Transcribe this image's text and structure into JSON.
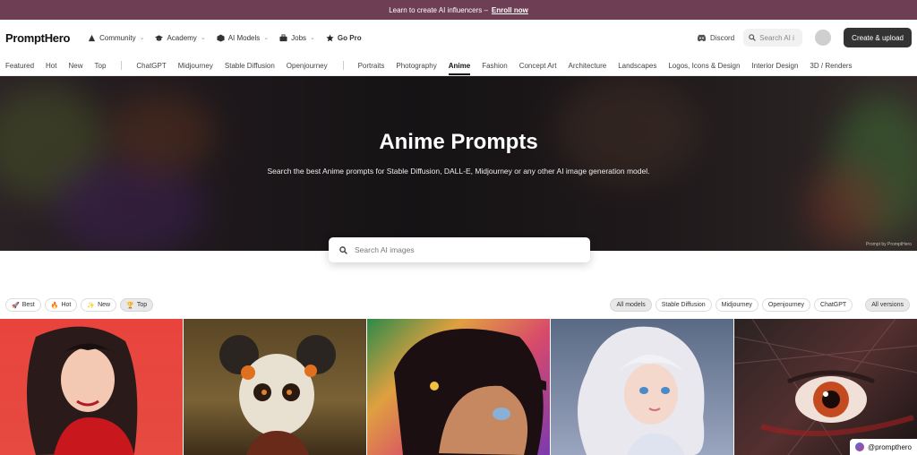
{
  "banner": {
    "text": "Learn to create AI influencers –",
    "link": "Enroll now"
  },
  "header": {
    "logo": "PromptHero",
    "nav": [
      {
        "label": "Community",
        "icon": "community-icon"
      },
      {
        "label": "Academy",
        "icon": "graduation-cap-icon"
      },
      {
        "label": "AI Models",
        "icon": "cube-icon"
      },
      {
        "label": "Jobs",
        "icon": "briefcase-icon"
      },
      {
        "label": "Go Pro",
        "icon": "star-icon"
      }
    ],
    "discord": "Discord",
    "search_placeholder": "Search AI i",
    "create_label": "Create & upload"
  },
  "categories": [
    "Featured",
    "Hot",
    "New",
    "Top",
    "ChatGPT",
    "Midjourney",
    "Stable Diffusion",
    "Openjourney",
    "Portraits",
    "Photography",
    "Anime",
    "Fashion",
    "Concept Art",
    "Architecture",
    "Landscapes",
    "Logos, Icons & Design",
    "Interior Design",
    "3D / Renders"
  ],
  "active_category": "Anime",
  "hero": {
    "title": "Anime Prompts",
    "subtitle": "Search the best Anime prompts for Stable Diffusion, DALL-E, Midjourney or any other AI image generation model.",
    "credit": "Prompt by PromptHero"
  },
  "search": {
    "placeholder": "Search AI images"
  },
  "sort_filters": [
    {
      "label": "Best",
      "icon": "rocket-icon",
      "selected": false
    },
    {
      "label": "Hot",
      "icon": "fire-icon",
      "selected": false
    },
    {
      "label": "New",
      "icon": "sparkle-icon",
      "selected": false
    },
    {
      "label": "Top",
      "icon": "trophy-icon",
      "selected": true
    }
  ],
  "model_filters": [
    {
      "label": "All models",
      "selected": true
    },
    {
      "label": "Stable Diffusion",
      "selected": false
    },
    {
      "label": "Midjourney",
      "selected": false
    },
    {
      "label": "Openjourney",
      "selected": false
    },
    {
      "label": "ChatGPT",
      "selected": false
    }
  ],
  "version_filter": "All versions",
  "image_badge": "@prompthero",
  "colors": {
    "banner": "#6e3e55",
    "create_button": "#333333"
  }
}
